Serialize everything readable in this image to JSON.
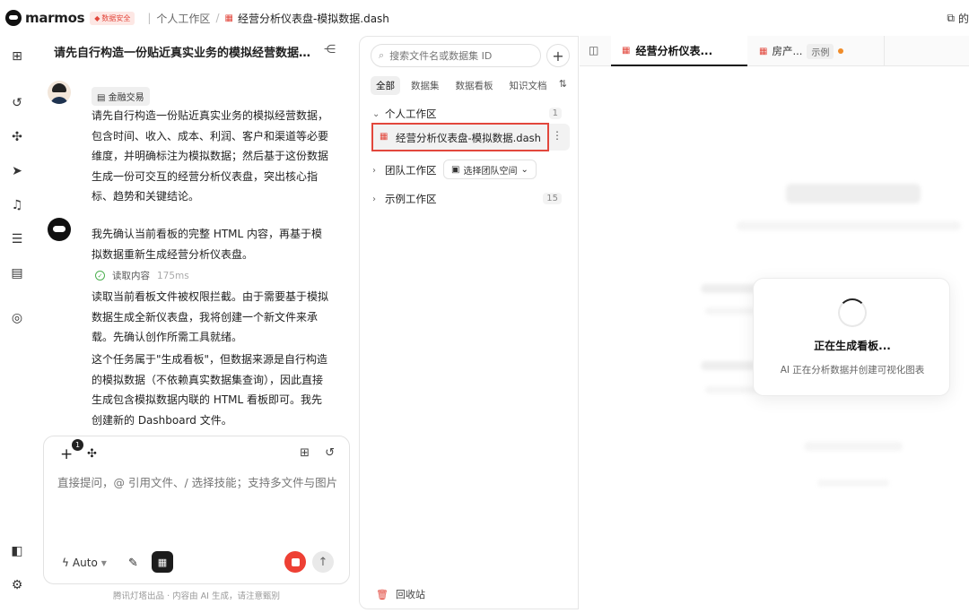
{
  "app": {
    "name": "marmos",
    "security_badge": "数据安全",
    "breadcrumb_workspace": "个人工作区",
    "breadcrumb_sep": "/",
    "breadcrumb_file": "经营分析仪表盘-模拟数据.dash",
    "top_right_label": "的"
  },
  "rail": {
    "icons": [
      "new-chat-icon",
      "history-icon",
      "plugin-icon",
      "send-icon",
      "bell-icon",
      "database-icon",
      "dashboard-icon",
      "compass-icon",
      "sidebar-toggle-icon",
      "settings-icon"
    ]
  },
  "chat": {
    "title": "请先自行构造一份贴近真实业务的模拟经营数据，...",
    "user_tag": "金融交易",
    "user_message": "请先自行构造一份贴近真实业务的模拟经营数据，包含时间、收入、成本、利润、客户和渠道等必要维度，并明确标注为模拟数据；然后基于这份数据生成一份可交互的经营分析仪表盘，突出核心指标、趋势和关键结论。",
    "bot_message_1": "我先确认当前看板的完整 HTML 内容，再基于模拟数据重新生成经营分析仪表盘。",
    "tool_label": "读取内容",
    "tool_time": "175ms",
    "bot_message_2": "读取当前看板文件被权限拦截。由于需要基于模拟数据生成全新仪表盘，我将创建一个新文件来承载。先确认创作所需工具就绪。",
    "bot_message_3": "这个任务属于\"生成看板\"，但数据来源是自行构造的模拟数据（不依赖真实数据集查询），因此直接生成包含模拟数据内联的 HTML 看板即可。我先创建新的 Dashboard 文件。"
  },
  "composer": {
    "attach_count": "1",
    "placeholder": "直接提问，@ 引用文件、/ 选择技能；支持多文件与图片",
    "mode": "Auto",
    "footnote": "腾讯灯塔出品 · 内容由 AI 生成，请注意甄别"
  },
  "files": {
    "search_placeholder": "搜索文件名或数据集 ID",
    "tabs": [
      "全部",
      "数据集",
      "数据看板",
      "知识文档"
    ],
    "active_tab": "全部",
    "personal": {
      "label": "个人工作区",
      "count": "1"
    },
    "file_name": "经营分析仪表盘-模拟数据.dash",
    "team": {
      "label": "团队工作区",
      "select": "选择团队空间"
    },
    "examples": {
      "label": "示例工作区",
      "count": "15"
    },
    "recycle": "回收站"
  },
  "tabs": {
    "tab1": "经营分析仪表...",
    "tab2": "房产...",
    "tab2_badge": "示例"
  },
  "loading": {
    "title": "正在生成看板...",
    "subtitle": "AI 正在分析数据并创建可视化图表"
  },
  "colors": {
    "accent_red": "#e2473c",
    "highlight_border": "#e2473c",
    "stop_button": "#ee4034",
    "unsaved_dot": "#f08c2a"
  }
}
